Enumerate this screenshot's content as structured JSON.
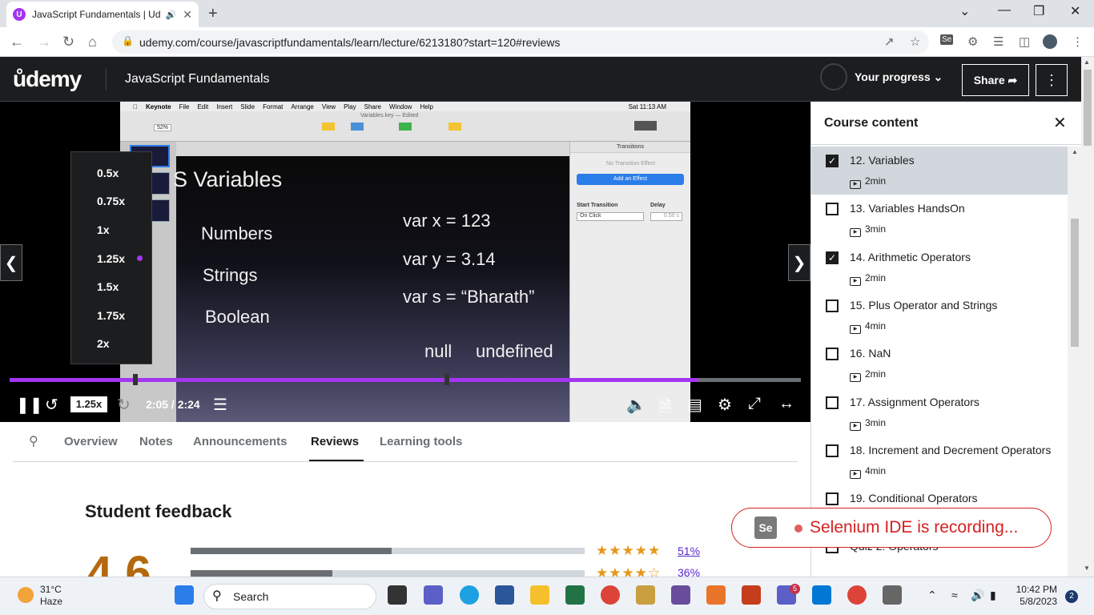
{
  "browser": {
    "tab_title": "JavaScript Fundamentals | Ud",
    "url": "udemy.com/course/javascriptfundamentals/learn/lecture/6213180?start=120#reviews"
  },
  "header": {
    "logo": "ůdemy",
    "course_title": "JavaScript Fundamentals",
    "progress_label": "Your progress",
    "share_label": "Share"
  },
  "player": {
    "slide": {
      "title": "S Variables",
      "left_items": [
        "Numbers",
        "Strings",
        "Boolean"
      ],
      "right_items": [
        "var x =  123",
        "var y = 3.14",
        "var s = “Bharath”"
      ],
      "bottom_items": [
        "null",
        "undefined"
      ],
      "keynote_menu": [
        "Keynote",
        "File",
        "Edit",
        "Insert",
        "Slide",
        "Format",
        "Arrange",
        "View",
        "Play",
        "Share",
        "Window",
        "Help"
      ],
      "keynote_file": "Variables.key — Edited",
      "keynote_clock": "Sat 11:13 AM",
      "keynote_zoom": "52%",
      "panel_title": "Transitions",
      "panel_none": "No Transition Effect",
      "panel_button": "Add an Effect",
      "panel_start": "Start Transition",
      "panel_delay": "Delay",
      "panel_onclick": "On Click",
      "panel_delay_val": "0.50 s"
    },
    "speed_options": [
      "0.5x",
      "0.75x",
      "1x",
      "1.25x",
      "1.5x",
      "1.75x",
      "2x"
    ],
    "selected_speed": "1.25x",
    "speed_button": "1.25x",
    "time": "2:05 / 2:24",
    "progress_fraction": 0.87
  },
  "tabs": {
    "items": [
      "Overview",
      "Notes",
      "Announcements",
      "Reviews",
      "Learning tools"
    ],
    "active": "Reviews"
  },
  "feedback": {
    "title": "Student feedback",
    "rating": "4.6",
    "rows": [
      {
        "stars": "★★★★★",
        "pct": "51%",
        "fraction": 0.51
      },
      {
        "stars": "★★★★☆",
        "pct": "36%",
        "fraction": 0.36
      }
    ]
  },
  "sidebar": {
    "title": "Course content",
    "items": [
      {
        "title": "12. Variables",
        "duration": "2min",
        "checked": true,
        "current": true
      },
      {
        "title": "13. Variables HandsOn",
        "duration": "3min",
        "checked": false,
        "current": false
      },
      {
        "title": "14. Arithmetic Operators",
        "duration": "2min",
        "checked": true,
        "current": false
      },
      {
        "title": "15. Plus Operator and Strings",
        "duration": "4min",
        "checked": false,
        "current": false
      },
      {
        "title": "16. NaN",
        "duration": "2min",
        "checked": false,
        "current": false
      },
      {
        "title": "17. Assignment Operators",
        "duration": "3min",
        "checked": false,
        "current": false
      },
      {
        "title": "18. Increment and Decrement Operators",
        "duration": "4min",
        "checked": false,
        "current": false
      },
      {
        "title": "19. Conditional Operators",
        "duration": "",
        "checked": false,
        "current": false
      },
      {
        "title": "Quiz 2: Operators",
        "duration": "",
        "checked": false,
        "current": false
      }
    ]
  },
  "selenium": {
    "logo": "Se",
    "text": "Selenium IDE is recording..."
  },
  "taskbar": {
    "temp": "31°C",
    "weather": "Haze",
    "search_placeholder": "Search",
    "time": "10:42 PM",
    "date": "5/8/2023",
    "teams_badge": "5",
    "notif_count": "2"
  },
  "colors": {
    "accent": "#a435f0",
    "dark": "#1c1d1f",
    "star": "#e59819",
    "rating": "#b4690e",
    "selenium_red": "#d42121"
  }
}
